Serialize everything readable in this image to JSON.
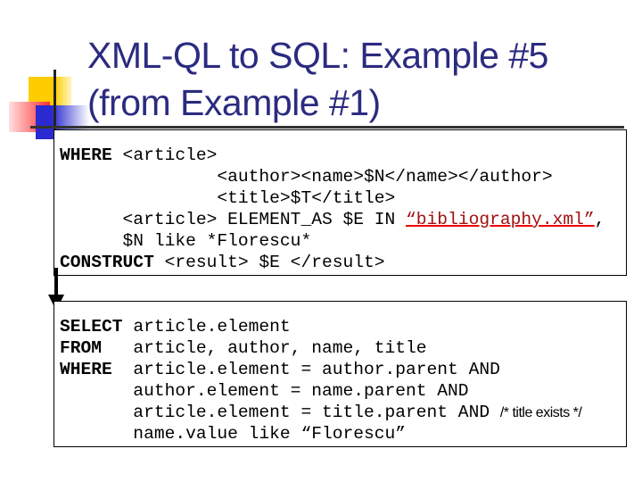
{
  "slide": {
    "title_line1": "XML-QL to SQL: Example #5",
    "title_line2": "(from Example #1)",
    "colors": {
      "title": "#2b2b80",
      "link": "#a01010",
      "underline": "#ee0000"
    }
  },
  "query1": {
    "kw_where": "WHERE",
    "l1": " <article>",
    "l2": "               <author><name>$N</name></author>",
    "l3": "               <title>$T</title>",
    "l4a": "      <article> ELEMENT_AS $E IN ",
    "l4_link": "“bibliography.xml”",
    "l4b": ",",
    "l5": "      $N like *Florescu*",
    "kw_construct": "CONSTRUCT",
    "l6": " <result> $E </result>"
  },
  "query2": {
    "kw_select": "SELECT",
    "l1": " article.element",
    "kw_from": "FROM",
    "l2": "   article, author, name, title",
    "kw_where": "WHERE",
    "l3": "  article.element = author.parent AND",
    "l4": "       author.element = name.parent AND",
    "l5": "       article.element = title.parent AND ",
    "l5_comment": "/* title exists */",
    "l6": "       name.value like “Florescu”"
  }
}
